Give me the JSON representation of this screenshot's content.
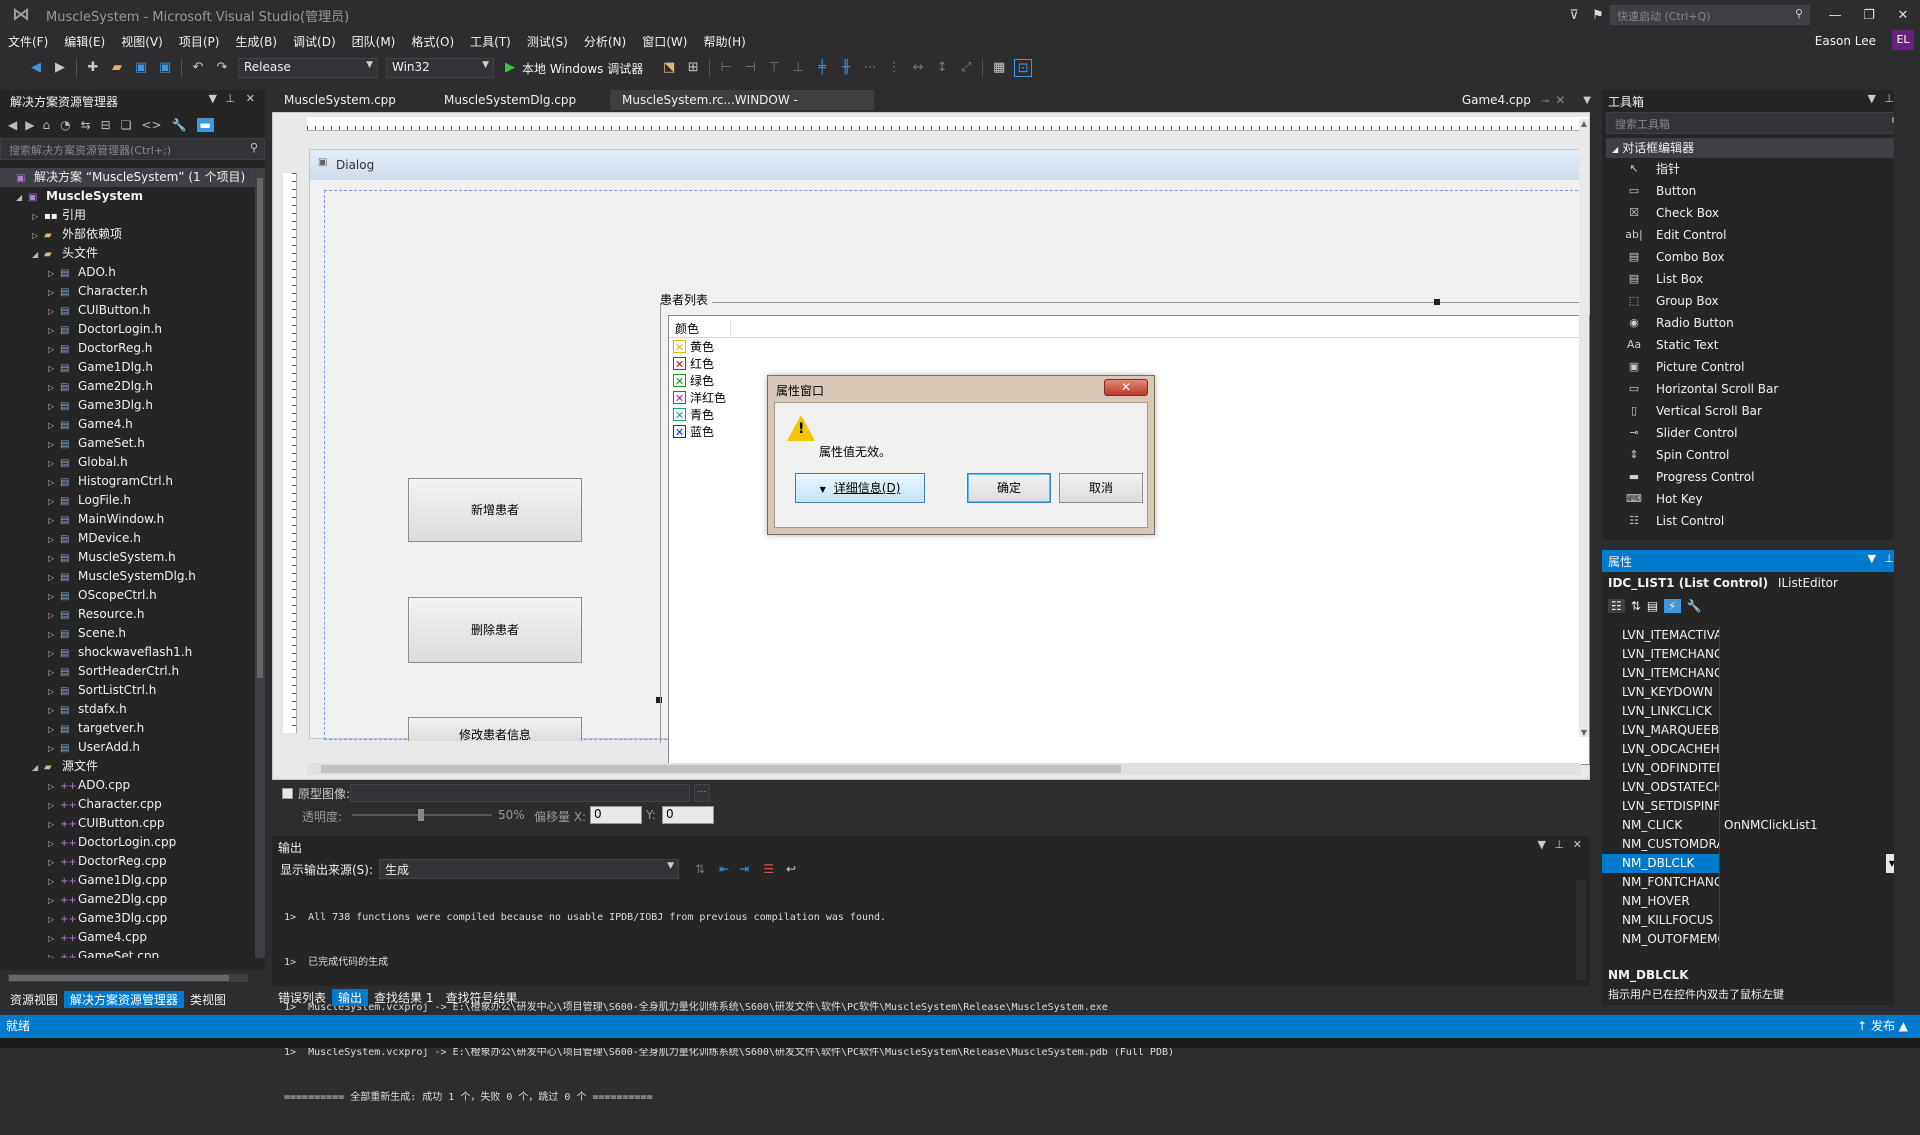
{
  "window": {
    "title": "MuscleSystem - Microsoft Visual Studio(管理员)",
    "quick_launch": "快速启动 (Ctrl+Q)",
    "user": "Eason Lee",
    "avatar": "EL"
  },
  "menu": [
    "文件(F)",
    "编辑(E)",
    "视图(V)",
    "项目(P)",
    "生成(B)",
    "调试(D)",
    "团队(M)",
    "格式(O)",
    "工具(T)",
    "测试(S)",
    "分析(N)",
    "窗口(W)",
    "帮助(H)"
  ],
  "toolbar": {
    "config": "Release",
    "platform": "Win32",
    "debugger": "本地 Windows 调试器"
  },
  "solution_explorer": {
    "title": "解决方案资源管理器",
    "search_placeholder": "搜索解决方案资源管理器(Ctrl+;)",
    "solution": "解决方案 “MuscleSystem” (1 个项目)",
    "project": "MuscleSystem",
    "refs": "引用",
    "external": "外部依赖项",
    "headers_folder": "头文件",
    "headers": [
      "ADO.h",
      "Character.h",
      "CUIButton.h",
      "DoctorLogin.h",
      "DoctorReg.h",
      "Game1Dlg.h",
      "Game2Dlg.h",
      "Game3Dlg.h",
      "Game4.h",
      "GameSet.h",
      "Global.h",
      "HistogramCtrl.h",
      "LogFile.h",
      "MainWindow.h",
      "MDevice.h",
      "MuscleSystem.h",
      "MuscleSystemDlg.h",
      "OScopeCtrl.h",
      "Resource.h",
      "Scene.h",
      "shockwaveflash1.h",
      "SortHeaderCtrl.h",
      "SortListCtrl.h",
      "stdafx.h",
      "targetver.h",
      "UserAdd.h"
    ],
    "sources_folder": "源文件",
    "sources": [
      "ADO.cpp",
      "Character.cpp",
      "CUIButton.cpp",
      "DoctorLogin.cpp",
      "DoctorReg.cpp",
      "Game1Dlg.cpp",
      "Game2Dlg.cpp",
      "Game3Dlg.cpp",
      "Game4.cpp",
      "GameSet.cpp"
    ],
    "bottom_tabs": [
      "资源视图",
      "解决方案资源管理器",
      "类视图"
    ]
  },
  "doc_tabs": [
    "MuscleSystem.cpp",
    "MuscleSystemDlg.cpp",
    "MuscleSystem.rc...WINDOW - Dialog",
    "Game4.cpp"
  ],
  "dialog": {
    "caption": "Dialog",
    "btn_add": "新增患者",
    "btn_delete": "删除患者",
    "btn_modify": "修改患者信息",
    "group_label": "患者列表",
    "list_header": "颜色",
    "list_items": [
      {
        "label": "黄色",
        "color": "#d4c000"
      },
      {
        "label": "红色",
        "color": "#cc1010"
      },
      {
        "label": "绿色",
        "color": "#10a010"
      },
      {
        "label": "洋红色",
        "color": "#c010c0"
      },
      {
        "label": "青色",
        "color": "#10a0a0"
      },
      {
        "label": "蓝色",
        "color": "#1030c0"
      }
    ]
  },
  "msgbox": {
    "title": "属性窗口",
    "message": "属性值无效。",
    "details_btn": "详细信息(D)",
    "ok_btn": "确定",
    "cancel_btn": "取消"
  },
  "designer_bar": {
    "prototype_label": "原型图像:",
    "opacity_label": "透明度:",
    "opacity_value": "50%",
    "offset_label": "偏移量 X:",
    "x_value": "0",
    "y_label": "Y:",
    "y_value": "0"
  },
  "output": {
    "title": "输出",
    "source_label": "显示输出来源(S):",
    "source_value": "生成",
    "lines": [
      "1>  All 738 functions were compiled because no usable IPDB/IOBJ from previous compilation was found.",
      "1>  已完成代码的生成",
      "1>  MuscleSystem.vcxproj -> E:\\橙象办公\\研发中心\\项目管理\\S600-全身肌力量化训练系统\\S600\\研发文件\\软件\\PC软件\\MuscleSystem\\Release\\MuscleSystem.exe",
      "1>  MuscleSystem.vcxproj -> E:\\橙象办公\\研发中心\\项目管理\\S600-全身肌力量化训练系统\\S600\\研发文件\\软件\\PC软件\\MuscleSystem\\Release\\MuscleSystem.pdb (Full PDB)",
      "========== 全部重新生成: 成功 1 个，失败 0 个，跳过 0 个 =========="
    ],
    "bottom_tabs": [
      "错误列表",
      "输出",
      "查找结果 1",
      "查找符号结果"
    ]
  },
  "toolbox": {
    "title": "工具箱",
    "search_placeholder": "搜索工具箱",
    "group": "对话框编辑器",
    "items": [
      {
        "label": "指针",
        "icon": "pointer-icon",
        "glyph": "↖"
      },
      {
        "label": "Button",
        "icon": "button-icon",
        "glyph": "▭"
      },
      {
        "label": "Check Box",
        "icon": "checkbox-icon",
        "glyph": "☒"
      },
      {
        "label": "Edit Control",
        "icon": "edit-icon",
        "glyph": "ab|"
      },
      {
        "label": "Combo Box",
        "icon": "combobox-icon",
        "glyph": "▤"
      },
      {
        "label": "List Box",
        "icon": "listbox-icon",
        "glyph": "▤"
      },
      {
        "label": "Group Box",
        "icon": "groupbox-icon",
        "glyph": "⬚"
      },
      {
        "label": "Radio Button",
        "icon": "radio-icon",
        "glyph": "◉"
      },
      {
        "label": "Static Text",
        "icon": "static-text-icon",
        "glyph": "Aa"
      },
      {
        "label": "Picture Control",
        "icon": "picture-icon",
        "glyph": "▣"
      },
      {
        "label": "Horizontal Scroll Bar",
        "icon": "hscroll-icon",
        "glyph": "▭"
      },
      {
        "label": "Vertical Scroll Bar",
        "icon": "vscroll-icon",
        "glyph": "▯"
      },
      {
        "label": "Slider Control",
        "icon": "slider-icon",
        "glyph": "⊸"
      },
      {
        "label": "Spin Control",
        "icon": "spin-icon",
        "glyph": "⇕"
      },
      {
        "label": "Progress Control",
        "icon": "progress-icon",
        "glyph": "▬"
      },
      {
        "label": "Hot Key",
        "icon": "hotkey-icon",
        "glyph": "⌨"
      },
      {
        "label": "List Control",
        "icon": "listcontrol-icon",
        "glyph": "☷"
      }
    ]
  },
  "properties": {
    "title": "属性",
    "object": "IDC_LIST1 (List Control)",
    "editor": "IListEditor",
    "rows": [
      {
        "k": "LVN_ITEMACTIVATE",
        "v": ""
      },
      {
        "k": "LVN_ITEMCHANGED",
        "v": ""
      },
      {
        "k": "LVN_ITEMCHANGIN",
        "v": ""
      },
      {
        "k": "LVN_KEYDOWN",
        "v": ""
      },
      {
        "k": "LVN_LINKCLICK",
        "v": ""
      },
      {
        "k": "LVN_MARQUEEBEGI",
        "v": ""
      },
      {
        "k": "LVN_ODCACHEHINT",
        "v": ""
      },
      {
        "k": "LVN_ODFINDITEM",
        "v": ""
      },
      {
        "k": "LVN_ODSTATECHAN",
        "v": ""
      },
      {
        "k": "LVN_SETDISPINFO",
        "v": ""
      },
      {
        "k": "NM_CLICK",
        "v": "OnNMClickList1"
      },
      {
        "k": "NM_CUSTOMDRAW",
        "v": ""
      },
      {
        "k": "NM_DBLCLK",
        "v": ""
      },
      {
        "k": "NM_FONTCHANGED",
        "v": ""
      },
      {
        "k": "NM_HOVER",
        "v": ""
      },
      {
        "k": "NM_KILLFOCUS",
        "v": ""
      },
      {
        "k": "NM_OUTOFMEMOR",
        "v": ""
      }
    ],
    "selected_index": 12,
    "desc_title": "NM_DBLCLK",
    "desc_text": "指示用户已在控件内双击了鼠标左键"
  },
  "status": {
    "text": "就绪",
    "publish": "↑ 发布 ▲"
  }
}
